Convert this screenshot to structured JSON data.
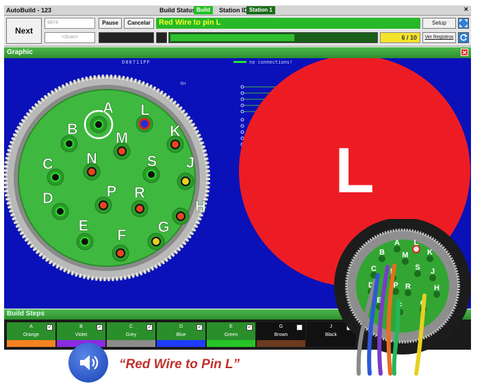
{
  "window": {
    "title": "AutoBuild - 123",
    "build_status_label": "Build Status:",
    "build_status_value": "Build",
    "station_label": "Station ID:",
    "station_value": "Station 1",
    "close_glyph": "×"
  },
  "toolbar": {
    "next_label": "Next",
    "field_top_value": "9874",
    "field_bottom_placeholder": "<Scan>",
    "pause_label": "Pause",
    "cancel_label": "Cancelar",
    "instruction": "Red Wire to pin L",
    "progress_fraction": 0.6,
    "step_counter": "6 / 10",
    "setup_label": "Setup",
    "registros_label": "Ver Registros"
  },
  "graphic": {
    "header": "Graphic",
    "part_number": "D80711PF",
    "no_connections_label": "no connections!",
    "sh_label": "SH",
    "current_pin": "L",
    "colors": {
      "background": "#0a11b8",
      "insert": "#3fb83f",
      "highlight": "#ed1c24"
    },
    "pins": [
      {
        "id": "A",
        "fill": "black"
      },
      {
        "id": "B",
        "fill": "black"
      },
      {
        "id": "C",
        "fill": "black"
      },
      {
        "id": "D",
        "fill": "black"
      },
      {
        "id": "E",
        "fill": "black"
      },
      {
        "id": "F",
        "fill": "red"
      },
      {
        "id": "G",
        "fill": "yellow"
      },
      {
        "id": "H",
        "fill": "red"
      },
      {
        "id": "J",
        "fill": "yellow"
      },
      {
        "id": "K",
        "fill": "red"
      },
      {
        "id": "L",
        "fill": "blue-red"
      },
      {
        "id": "M",
        "fill": "red"
      },
      {
        "id": "N",
        "fill": "red"
      },
      {
        "id": "P",
        "fill": "red"
      },
      {
        "id": "R",
        "fill": "red"
      },
      {
        "id": "S",
        "fill": "black"
      }
    ]
  },
  "build_steps": {
    "header": "Build Steps",
    "items": [
      {
        "letter": "A",
        "name": "Orange",
        "swatch": "#f58220",
        "checked": true
      },
      {
        "letter": "B",
        "name": "Violet",
        "swatch": "#8a2be2",
        "checked": true
      },
      {
        "letter": "C",
        "name": "Grey",
        "swatch": "#8c8c8c",
        "checked": true
      },
      {
        "letter": "D",
        "name": "Blue",
        "swatch": "#1e3cff",
        "checked": true
      },
      {
        "letter": "E",
        "name": "Green",
        "swatch": "#27c427",
        "checked": true
      },
      {
        "letter": "G",
        "name": "Brown",
        "swatch": "#6b3a1f",
        "checked": false
      },
      {
        "letter": "J",
        "name": "Black",
        "swatch": "#111111",
        "checked": false
      }
    ]
  },
  "callout": {
    "icon": "speaker-icon",
    "text": "“Red Wire to Pin L”"
  },
  "photo": {
    "pin_labels": [
      "A",
      "B",
      "C",
      "D",
      "E",
      "F",
      "G",
      "H",
      "J",
      "K",
      "L",
      "M",
      "N",
      "P",
      "R",
      "S"
    ]
  }
}
